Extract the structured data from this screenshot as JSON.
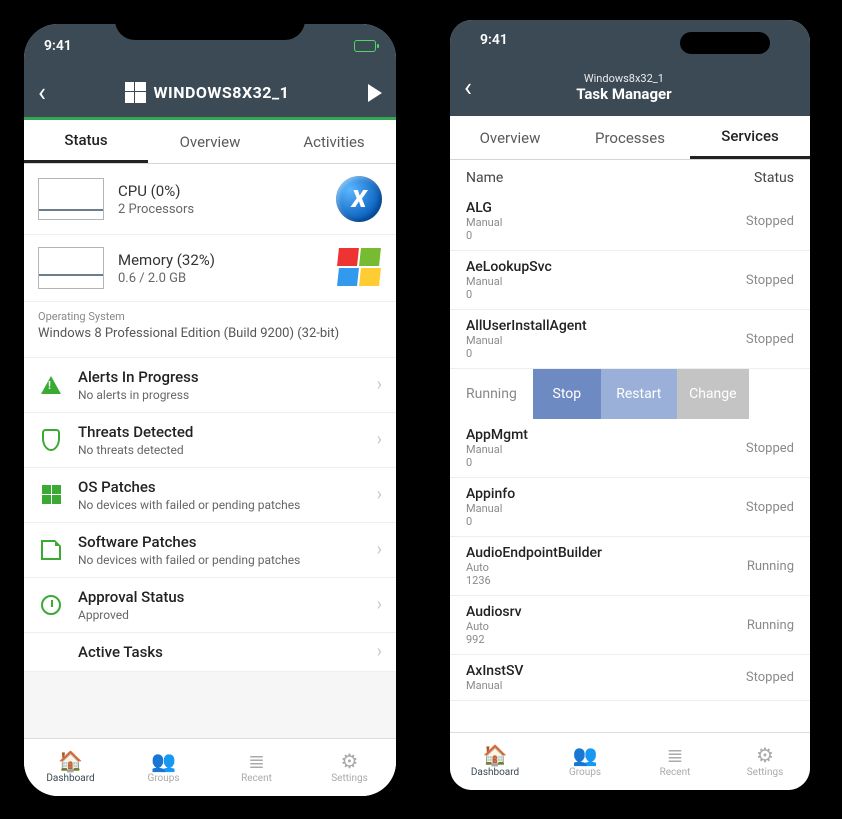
{
  "statusbar_time": "9:41",
  "phone1": {
    "title": "WINDOWS8X32_1",
    "tabs": [
      "Status",
      "Overview",
      "Activities"
    ],
    "active_tab": 0,
    "cpu": {
      "title": "CPU (0%)",
      "sub": "2 Processors"
    },
    "mem": {
      "title": "Memory (32%)",
      "sub": "0.6 / 2.0 GB"
    },
    "os_label": "Operating System",
    "os_value": "Windows 8 Professional Edition (Build 9200) (32-bit)",
    "rows": [
      {
        "icon": "warn",
        "title": "Alerts In Progress",
        "sub": "No alerts in progress"
      },
      {
        "icon": "shield",
        "title": "Threats Detected",
        "sub": "No threats detected"
      },
      {
        "icon": "wgreen",
        "title": "OS Patches",
        "sub": "No devices with failed or pending patches"
      },
      {
        "icon": "floppy",
        "title": "Software Patches",
        "sub": "No devices with failed or pending patches"
      },
      {
        "icon": "clock",
        "title": "Approval Status",
        "sub": "Approved"
      },
      {
        "icon": "",
        "title": "Active Tasks",
        "sub": ""
      }
    ]
  },
  "phone2": {
    "breadcrumb": "Windows8x32_1",
    "title": "Task Manager",
    "tabs": [
      "Overview",
      "Processes",
      "Services"
    ],
    "active_tab": 2,
    "col_name": "Name",
    "col_status": "Status",
    "actions": {
      "running": "Running",
      "stop": "Stop",
      "restart": "Restart",
      "change": "Change"
    },
    "services": [
      {
        "name": "ALG",
        "mode": "Manual",
        "pid": "0",
        "status": "Stopped"
      },
      {
        "name": "AeLookupSvc",
        "mode": "Manual",
        "pid": "0",
        "status": "Stopped"
      },
      {
        "name": "AllUserInstallAgent",
        "mode": "Manual",
        "pid": "0",
        "status": "Stopped"
      },
      {
        "name": "AppMgmt",
        "mode": "Manual",
        "pid": "0",
        "status": "Stopped"
      },
      {
        "name": "Appinfo",
        "mode": "Manual",
        "pid": "0",
        "status": "Stopped"
      },
      {
        "name": "AudioEndpointBuilder",
        "mode": "Auto",
        "pid": "1236",
        "status": "Running"
      },
      {
        "name": "Audiosrv",
        "mode": "Auto",
        "pid": "992",
        "status": "Running"
      },
      {
        "name": "AxInstSV",
        "mode": "Manual",
        "pid": "",
        "status": "Stopped"
      }
    ],
    "actions_after_index": 2
  },
  "bottomnav": [
    {
      "label": "Dashboard",
      "icon": "🏠"
    },
    {
      "label": "Groups",
      "icon": "👥"
    },
    {
      "label": "Recent",
      "icon": "≣"
    },
    {
      "label": "Settings",
      "icon": "⚙"
    }
  ]
}
